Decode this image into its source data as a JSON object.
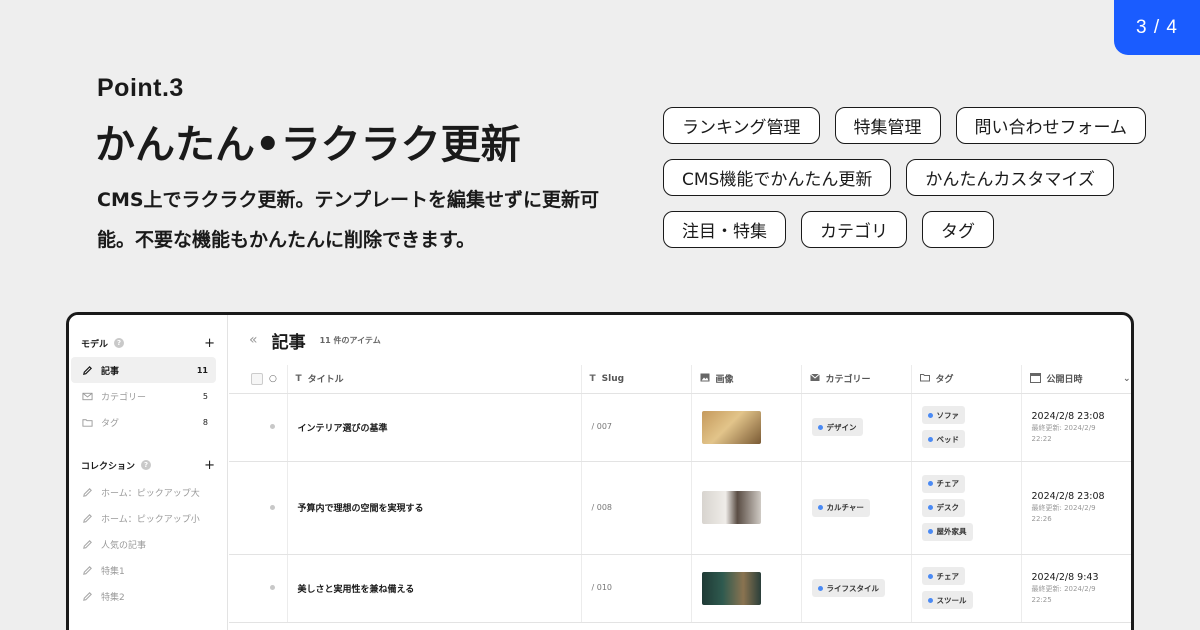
{
  "page_indicator": "3 / 4",
  "point_label": "Point.3",
  "headline": "かんたん•ラクラク更新",
  "description": "CMS上でラクラク更新。テンプレートを編集せずに更新可能。不要な機能もかんたんに削除できます。",
  "tags": [
    [
      "ランキング管理",
      "特集管理",
      "問い合わせフォーム"
    ],
    [
      "CMS機能でかんたん更新",
      "かんたんカスタマイズ"
    ],
    [
      "注目・特集",
      "カテゴリ",
      "タグ"
    ]
  ],
  "app": {
    "sidebar": {
      "models_label": "モデル",
      "models": [
        {
          "label": "記事",
          "count": "11",
          "icon": "pencil-icon"
        },
        {
          "label": "カテゴリー",
          "count": "5",
          "icon": "mail-icon"
        },
        {
          "label": "タグ",
          "count": "8",
          "icon": "folder-icon"
        }
      ],
      "collections_label": "コレクション",
      "collections": [
        {
          "label": "ホーム：ピックアップ大"
        },
        {
          "label": "ホーム：ピックアップ小"
        },
        {
          "label": "人気の記事"
        },
        {
          "label": "特集1"
        },
        {
          "label": "特集2"
        }
      ]
    },
    "main": {
      "collapse_icon": "«",
      "title": "記事",
      "count": "11 件のアイテム",
      "columns": [
        "タイトル",
        "Slug",
        "画像",
        "カテゴリー",
        "タグ",
        "公開日時"
      ],
      "rows": [
        {
          "title": "インテリア選びの基準",
          "slug": "/ 007",
          "thumb_colors": [
            "#d6b27a",
            "#8a6a3c"
          ],
          "category": "デザイン",
          "tags": [
            "ソファ",
            "ベッド"
          ],
          "date": "2024/2/8 23:08",
          "updated_label": "最終更新: 2024/2/9",
          "updated_time": "22:22"
        },
        {
          "title": "予算内で理想の空間を実現する",
          "slug": "/ 008",
          "thumb_colors": [
            "#e6e3de",
            "#6b5d52"
          ],
          "category": "カルチャー",
          "tags": [
            "チェア",
            "デスク",
            "屋外家具"
          ],
          "date": "2024/2/8 23:08",
          "updated_label": "最終更新: 2024/2/9",
          "updated_time": "22:26"
        },
        {
          "title": "美しさと実用性を兼ね備える",
          "slug": "/ 010",
          "thumb_colors": [
            "#2f4a44",
            "#7b6a4a"
          ],
          "category": "ライフスタイル",
          "tags": [
            "チェア",
            "スツール"
          ],
          "date": "2024/2/8 9:43",
          "updated_label": "最終更新: 2024/2/9",
          "updated_time": "22:25"
        }
      ]
    }
  }
}
